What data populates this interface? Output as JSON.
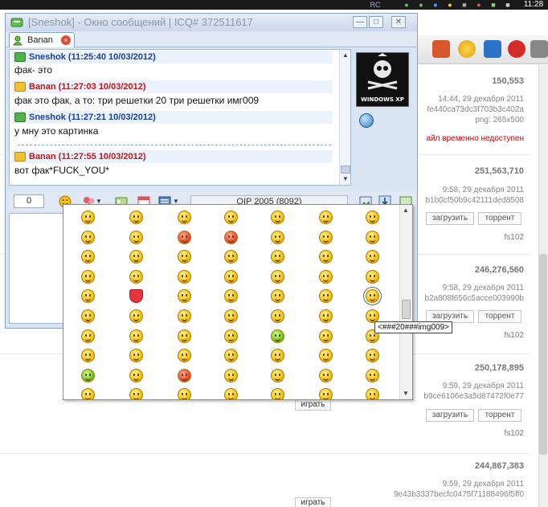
{
  "taskbar": {
    "lang": "RC",
    "clock": "11:28"
  },
  "window": {
    "title": "[Sneshok] - Окно сообщений | ICQ# 372511617",
    "min": "—",
    "max": "□",
    "close": "✕"
  },
  "tab": {
    "label": "Banan",
    "close": "×"
  },
  "messages": [
    {
      "author": "sneshok",
      "header": "Sneshok (11:25:40 10/03/2012)",
      "text": "фак- это"
    },
    {
      "author": "banan",
      "header": "Banan (11:27:03 10/03/2012)",
      "text": "фак это фак, а то: три решетки 20 три решетки имг009"
    },
    {
      "author": "sneshok",
      "header": "Sneshok (11:27:21 10/03/2012)",
      "text": "у мну это картинка"
    },
    {
      "author": "banan",
      "header": "Banan (11:27:55 10/03/2012)",
      "text": "вот фак*FUCK_YOU*"
    }
  ],
  "avatar": {
    "caption": "WINDOWS XP"
  },
  "toolbar": {
    "counter": "0",
    "encoding": "QIP 2005 (8092)"
  },
  "tooltip": "<###20###img009>",
  "torrents": [
    {
      "size": "150,553",
      "date": "14:44, 29 декабря 2011",
      "hash": "fe440ca73dc3f703b3c402a",
      "png": "png: 265x500",
      "error": "айл временно недоступен"
    },
    {
      "size": "251,563,710",
      "date": "9:58, 29 декабря 2011",
      "hash": "b1b0cf50b9c42111ded8508",
      "load": "загрузить",
      "torrent": "торрент",
      "user": "fs102"
    },
    {
      "size": "246,276,560",
      "date": "9:58, 29 декабря 2011",
      "hash": "b2a808f656c5acce003990b",
      "load": "загрузить",
      "torrent": "торрент",
      "user": "fs102"
    },
    {
      "size": "250,178,895",
      "date": "9:59, 29 декабря 2011",
      "hash": "b9ce6106e3a5d87472f0e77",
      "load": "загрузить",
      "torrent": "торрент",
      "user": "fs102"
    },
    {
      "size": "244,867,383",
      "date": "9:59, 29 декабря 2011",
      "hash": "9e43b3337becfc0475f71188496f5ff0"
    }
  ],
  "play_label": "играть"
}
